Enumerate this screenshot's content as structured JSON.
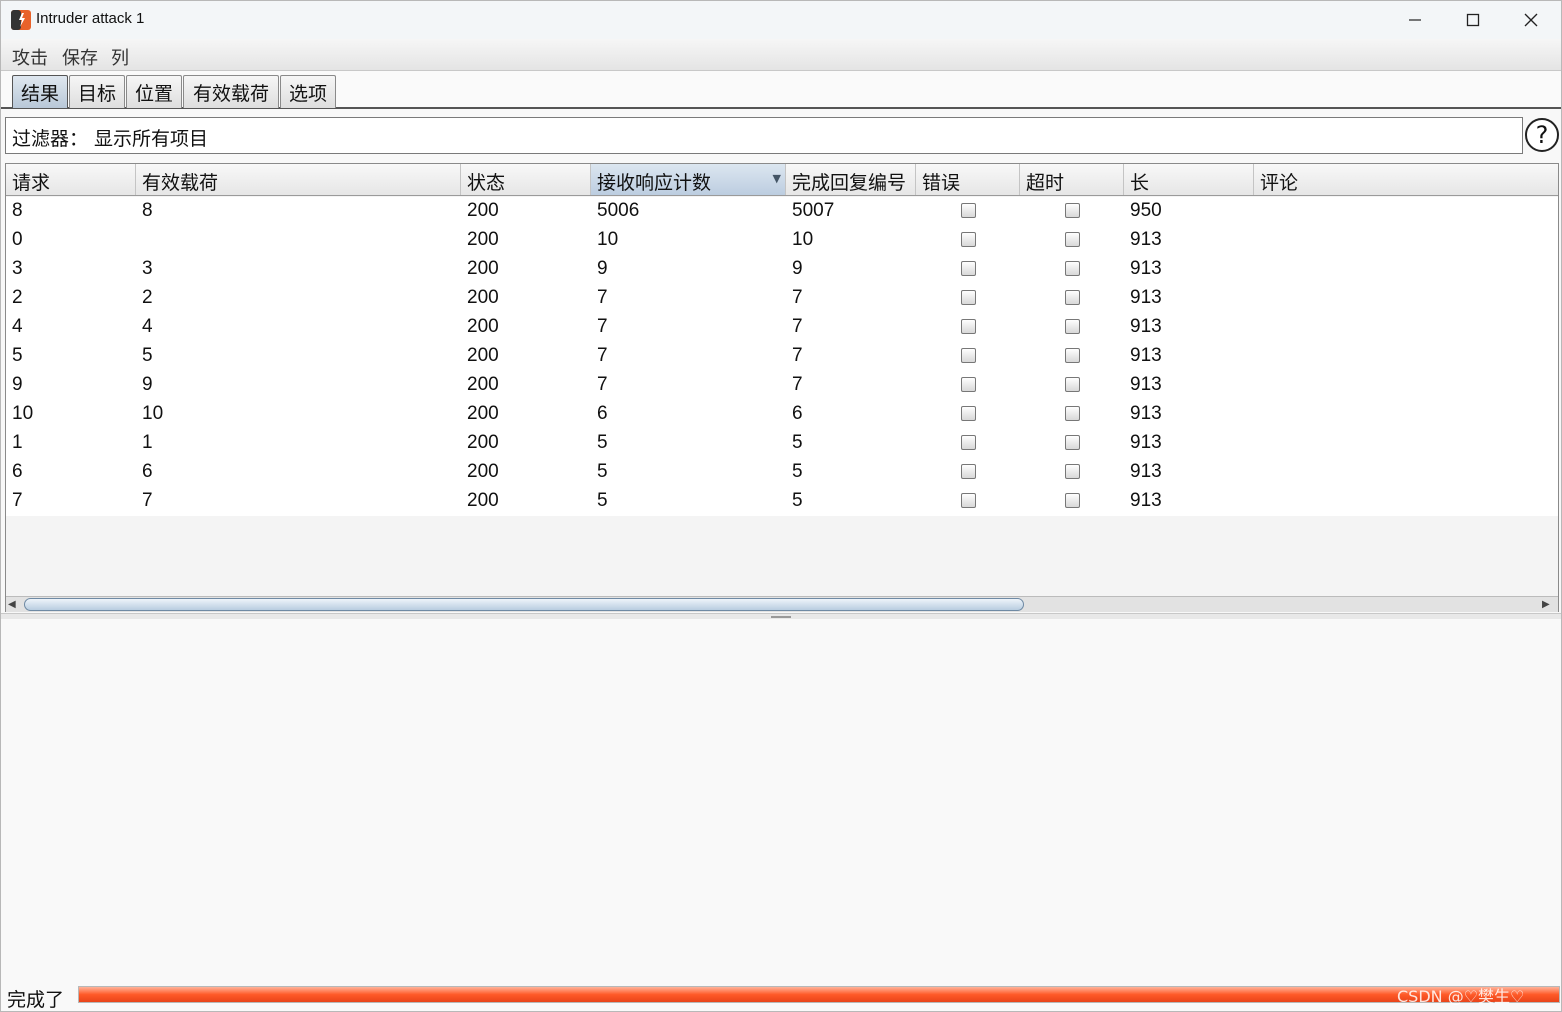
{
  "window": {
    "title": "Intruder attack 1",
    "icon": "burp-icon"
  },
  "menu": {
    "items": [
      {
        "label": "攻击"
      },
      {
        "label": "保存"
      },
      {
        "label": "列"
      }
    ]
  },
  "tabs": [
    {
      "label": "结果",
      "active": true
    },
    {
      "label": "目标",
      "active": false
    },
    {
      "label": "位置",
      "active": false
    },
    {
      "label": "有效载荷",
      "active": false
    },
    {
      "label": "选项",
      "active": false
    }
  ],
  "filter": {
    "text": "过滤器：  显示所有项目",
    "help": "?"
  },
  "table": {
    "columns": [
      "请求",
      "有效载荷",
      "状态",
      "接收响应计数",
      "完成回复编号",
      "错误",
      "超时",
      "长",
      "评论"
    ],
    "sorted_column": "接收响应计数",
    "sort_arrow": "▼",
    "rows": [
      {
        "request": "8",
        "payload": "8",
        "status": "200",
        "received": "5006",
        "completed": "5007",
        "error": false,
        "timeout": false,
        "length": "950",
        "comment": ""
      },
      {
        "request": "0",
        "payload": "",
        "status": "200",
        "received": "10",
        "completed": "10",
        "error": false,
        "timeout": false,
        "length": "913",
        "comment": ""
      },
      {
        "request": "3",
        "payload": "3",
        "status": "200",
        "received": "9",
        "completed": "9",
        "error": false,
        "timeout": false,
        "length": "913",
        "comment": ""
      },
      {
        "request": "2",
        "payload": "2",
        "status": "200",
        "received": "7",
        "completed": "7",
        "error": false,
        "timeout": false,
        "length": "913",
        "comment": ""
      },
      {
        "request": "4",
        "payload": "4",
        "status": "200",
        "received": "7",
        "completed": "7",
        "error": false,
        "timeout": false,
        "length": "913",
        "comment": ""
      },
      {
        "request": "5",
        "payload": "5",
        "status": "200",
        "received": "7",
        "completed": "7",
        "error": false,
        "timeout": false,
        "length": "913",
        "comment": ""
      },
      {
        "request": "9",
        "payload": "9",
        "status": "200",
        "received": "7",
        "completed": "7",
        "error": false,
        "timeout": false,
        "length": "913",
        "comment": ""
      },
      {
        "request": "10",
        "payload": "10",
        "status": "200",
        "received": "6",
        "completed": "6",
        "error": false,
        "timeout": false,
        "length": "913",
        "comment": ""
      },
      {
        "request": "1",
        "payload": "1",
        "status": "200",
        "received": "5",
        "completed": "5",
        "error": false,
        "timeout": false,
        "length": "913",
        "comment": ""
      },
      {
        "request": "6",
        "payload": "6",
        "status": "200",
        "received": "5",
        "completed": "5",
        "error": false,
        "timeout": false,
        "length": "913",
        "comment": ""
      },
      {
        "request": "7",
        "payload": "7",
        "status": "200",
        "received": "5",
        "completed": "5",
        "error": false,
        "timeout": false,
        "length": "913",
        "comment": ""
      }
    ]
  },
  "status": {
    "text": "完成了",
    "progress_fraction": 1.0,
    "progress_color": "#ff5a28"
  },
  "watermark": "CSDN @♡樊生♡"
}
